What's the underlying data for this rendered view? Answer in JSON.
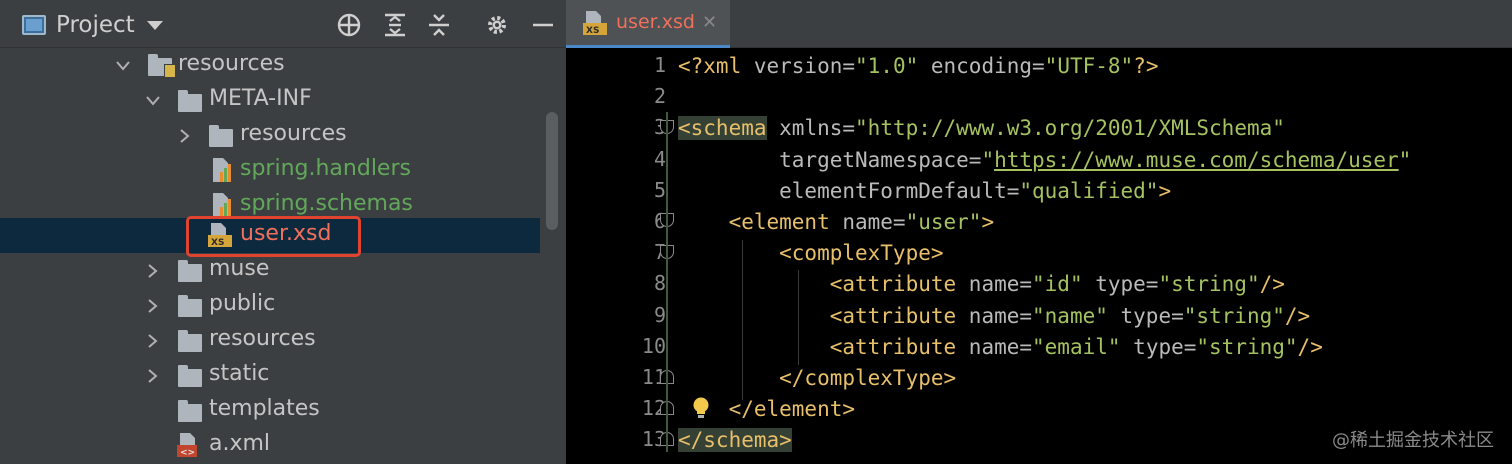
{
  "project_panel": {
    "title": "Project",
    "tree": [
      {
        "label": "resources",
        "kind": "resource-folder",
        "expanded": true,
        "color": "gray"
      },
      {
        "label": "META-INF",
        "kind": "folder",
        "expanded": true,
        "color": "gray"
      },
      {
        "label": "resources",
        "kind": "folder",
        "expanded": false,
        "color": "gray"
      },
      {
        "label": "spring.handlers",
        "kind": "properties-file",
        "color": "green"
      },
      {
        "label": "spring.schemas",
        "kind": "properties-file",
        "color": "green"
      },
      {
        "label": "user.xsd",
        "kind": "xsd-file",
        "color": "red",
        "selected": true
      },
      {
        "label": "muse",
        "kind": "folder",
        "expanded": false,
        "color": "gray"
      },
      {
        "label": "public",
        "kind": "folder",
        "expanded": false,
        "color": "gray"
      },
      {
        "label": "resources",
        "kind": "folder",
        "expanded": false,
        "color": "gray"
      },
      {
        "label": "static",
        "kind": "folder",
        "expanded": false,
        "color": "gray"
      },
      {
        "label": "templates",
        "kind": "folder",
        "color": "gray"
      },
      {
        "label": "a.xml",
        "kind": "xml-file",
        "color": "gray"
      }
    ],
    "icons": [
      "crosshair-icon",
      "expand-all-icon",
      "collapse-all-icon",
      "gear-icon",
      "minimize-icon"
    ]
  },
  "editor": {
    "tab_label": "user.xsd",
    "tab_badge": "XS",
    "line_numbers": [
      "1",
      "2",
      "3",
      "4",
      "5",
      "6",
      "7",
      "8",
      "9",
      "10",
      "11",
      "12",
      "13"
    ],
    "lines": [
      {
        "tokens": [
          [
            "p",
            "<?xml "
          ],
          [
            "a",
            "version="
          ],
          [
            "v",
            "\"1.0\""
          ],
          [
            "a",
            " encoding="
          ],
          [
            "v",
            "\"UTF-8\""
          ],
          [
            "p",
            "?>"
          ]
        ]
      },
      {
        "tokens": []
      },
      {
        "tokens": [
          [
            "t",
            "<schema"
          ],
          [
            "a",
            " xmlns="
          ],
          [
            "v",
            "\"http://www.w3.org/2001/XMLSchema\""
          ]
        ]
      },
      {
        "tokens": [
          [
            "a",
            "        targetNamespace="
          ],
          [
            "v",
            "\""
          ],
          [
            "vu",
            "https://www.muse.com/schema/user"
          ],
          [
            "v",
            "\""
          ]
        ]
      },
      {
        "tokens": [
          [
            "a",
            "        elementFormDefault="
          ],
          [
            "v",
            "\"qualified\""
          ],
          [
            "t",
            ">"
          ]
        ]
      },
      {
        "tokens": [
          [
            "t",
            "    <element"
          ],
          [
            "a",
            " name="
          ],
          [
            "v",
            "\"user\""
          ],
          [
            "t",
            ">"
          ]
        ]
      },
      {
        "tokens": [
          [
            "t",
            "        <complexType>"
          ]
        ]
      },
      {
        "tokens": [
          [
            "t",
            "            <attribute"
          ],
          [
            "a",
            " name="
          ],
          [
            "v",
            "\"id\""
          ],
          [
            "a",
            " type="
          ],
          [
            "v",
            "\"string\""
          ],
          [
            "t",
            "/>"
          ]
        ]
      },
      {
        "tokens": [
          [
            "t",
            "            <attribute"
          ],
          [
            "a",
            " name="
          ],
          [
            "v",
            "\"name\""
          ],
          [
            "a",
            " type="
          ],
          [
            "v",
            "\"string\""
          ],
          [
            "t",
            "/>"
          ]
        ]
      },
      {
        "tokens": [
          [
            "t",
            "            <attribute"
          ],
          [
            "a",
            " name="
          ],
          [
            "v",
            "\"email\""
          ],
          [
            "a",
            " type="
          ],
          [
            "v",
            "\"string\""
          ],
          [
            "t",
            "/>"
          ]
        ]
      },
      {
        "tokens": [
          [
            "t",
            "        </complexType>"
          ]
        ]
      },
      {
        "tokens": [
          [
            "t",
            "    </element>"
          ]
        ]
      },
      {
        "tokens": [
          [
            "t",
            "</schema>"
          ]
        ]
      }
    ]
  },
  "watermark": "@稀土掘金技术社区",
  "colors": {
    "selection": "#0d293e",
    "highlight_border": "#e0432e",
    "tab_accent": "#4a88c7"
  }
}
